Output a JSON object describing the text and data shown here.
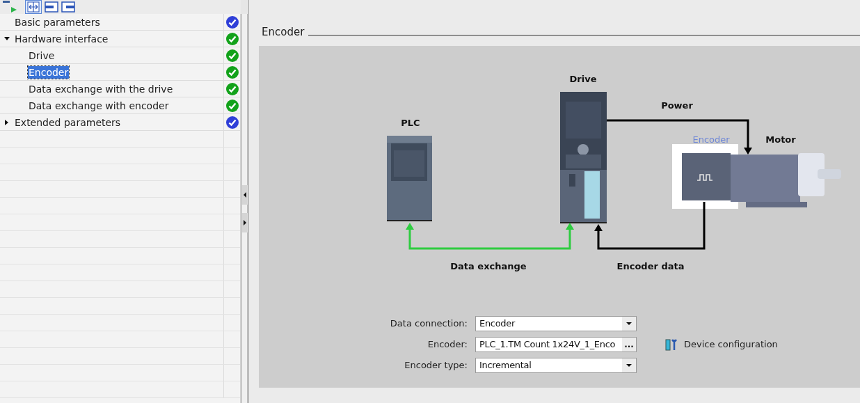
{
  "tree": [
    {
      "label": "Basic parameters",
      "selected": false,
      "color": "#2f3fd8"
    },
    {
      "label": "Hardware interface",
      "selected": false,
      "expanded": true,
      "color": "#12a21a",
      "children": [
        {
          "label": "Drive",
          "selected": false,
          "color": "#12a21a"
        },
        {
          "label": "Encoder",
          "selected": true,
          "color": "#12a21a"
        },
        {
          "label": "Data exchange with the drive",
          "selected": false,
          "color": "#12a21a"
        },
        {
          "label": "Data exchange with encoder",
          "selected": false,
          "color": "#12a21a"
        }
      ]
    },
    {
      "label": "Extended parameters",
      "selected": false,
      "expanded": false,
      "color": "#2f3fd8"
    }
  ],
  "section": {
    "title": "Encoder"
  },
  "diagram": {
    "plc": "PLC",
    "drive": "Drive",
    "power": "Power",
    "encoder": "Encoder",
    "motor": "Motor",
    "data_exchange": "Data exchange",
    "encoder_data": "Encoder data"
  },
  "form": [
    {
      "label": "Data connection:",
      "value": "Encoder",
      "kind": "dropdown"
    },
    {
      "label": "Encoder:",
      "value": "PLC_1.TM Count 1x24V_1_Enco",
      "kind": "browse",
      "button": "...",
      "link": "Device configuration"
    },
    {
      "label": "Encoder type:",
      "value": "Incremental",
      "kind": "dropdown"
    }
  ]
}
